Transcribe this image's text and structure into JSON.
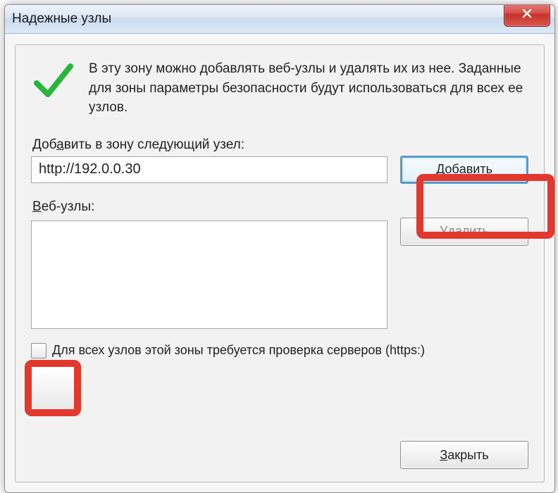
{
  "window": {
    "title": "Надежные узлы"
  },
  "intro": {
    "text": "В эту зону можно добавлять веб-узлы и удалять их из нее. Заданные для зоны параметры безопасности будут использоваться для всех ее узлов."
  },
  "add_section": {
    "label_pre": "Доб",
    "label_u": "а",
    "label_post": "вить в зону следующий узел:",
    "value": "http://192.0.0.30",
    "button_pre": "Доб",
    "button_u": "а",
    "button_post": "вить"
  },
  "list_section": {
    "label_u": "В",
    "label_post": "еб-узлы:",
    "remove_u": "У",
    "remove_post": "далить"
  },
  "checkbox": {
    "checked": false,
    "label": "Для всех узлов этой зоны требуется проверка серверов (https:)"
  },
  "footer": {
    "close_u": "З",
    "close_post": "акрыть"
  }
}
